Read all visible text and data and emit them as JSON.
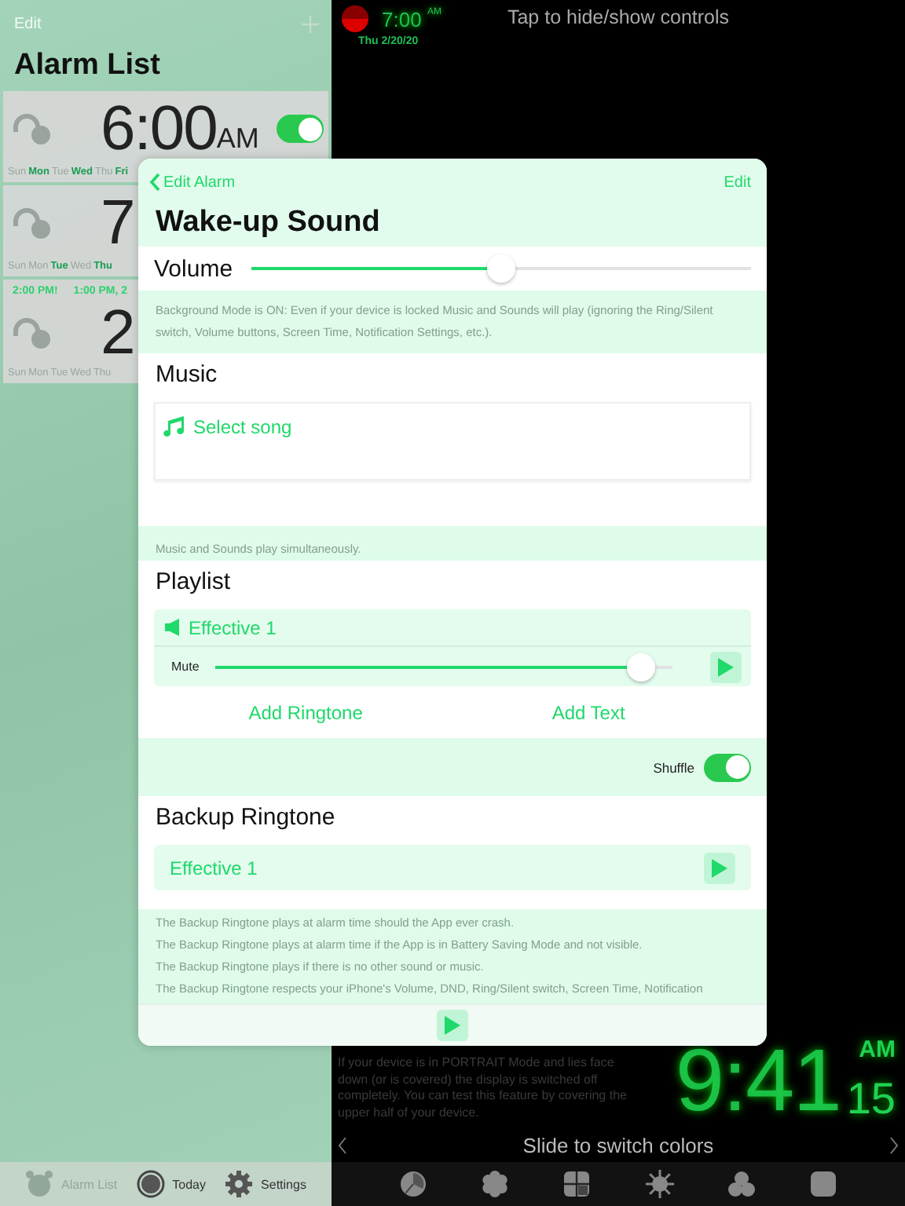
{
  "alarm_list": {
    "edit": "Edit",
    "title": "Alarm List",
    "alarms": [
      {
        "time": "6:00",
        "ampm": "AM",
        "on": true,
        "days": [
          {
            "label": "Sun",
            "selected": false
          },
          {
            "label": "Mon",
            "selected": true
          },
          {
            "label": "Tue",
            "selected": false
          },
          {
            "label": "Wed",
            "selected": true
          },
          {
            "label": "Thu",
            "selected": false
          },
          {
            "label": "Fri",
            "selected": true
          }
        ]
      },
      {
        "time": "7",
        "days": [
          {
            "label": "Sun",
            "selected": false
          },
          {
            "label": "Mon",
            "selected": false
          },
          {
            "label": "Tue",
            "selected": true
          },
          {
            "label": "Wed",
            "selected": false
          },
          {
            "label": "Thu",
            "selected": true
          }
        ]
      },
      {
        "info": [
          "2:00 PM!",
          "1:00 PM, 2"
        ],
        "time": "2",
        "days": [
          {
            "label": "Sun",
            "selected": false
          },
          {
            "label": "Mon",
            "selected": false
          },
          {
            "label": "Tue",
            "selected": false
          },
          {
            "label": "Wed",
            "selected": false
          },
          {
            "label": "Thu",
            "selected": false
          }
        ]
      }
    ]
  },
  "tab_bar": [
    {
      "label": "Alarm List",
      "disabled": true
    },
    {
      "label": "Today",
      "disabled": false
    },
    {
      "label": "Settings",
      "disabled": false
    }
  ],
  "clock": {
    "time": "7:00",
    "ampm": "AM",
    "date": "Thu 2/20/20"
  },
  "hint": "Tap to hide/show controls",
  "portrait_note": "If your device is in PORTRAIT Mode and lies face down (or is covered) the display is switched off completely. You can test this feature by covering the upper half of your device.",
  "big_clock": {
    "time": "9:41",
    "ampm": "AM",
    "seconds": "15"
  },
  "slide_hint": "Slide to switch colors",
  "edit_sheet": {
    "back": "Edit Alarm",
    "action": "Edit",
    "title": "Wake-up Sound",
    "volume": {
      "label": "Volume",
      "level": 0.5
    },
    "volume_note": "Background Mode is ON: Even if your device is locked Music and Sounds will play (ignoring the Ring/Silent switch, Volume buttons, Screen Time, Notification Settings, etc.).",
    "music": {
      "heading": "Music",
      "select": "Select song"
    },
    "music_note": "Music and Sounds play simultaneously.",
    "playlist": {
      "heading": "Playlist",
      "items": [
        {
          "name": "Effective 1",
          "mute_label": "Mute",
          "level": 0.96
        }
      ],
      "add_ringtone": "Add Ringtone",
      "add_text": "Add Text"
    },
    "shuffle": {
      "label": "Shuffle",
      "on": true
    },
    "backup": {
      "heading": "Backup Ringtone",
      "ringtone": "Effective 1"
    },
    "backup_notes": [
      "The Backup Ringtone plays at alarm time should the App ever crash.",
      "The Backup Ringtone plays at alarm time if the App is in Battery Saving Mode and not visible.",
      "The Backup Ringtone plays if there is no other sound or music.",
      "The Backup Ringtone respects your iPhone's Volume, DND, Ring/Silent switch, Screen Time, Notification"
    ]
  }
}
